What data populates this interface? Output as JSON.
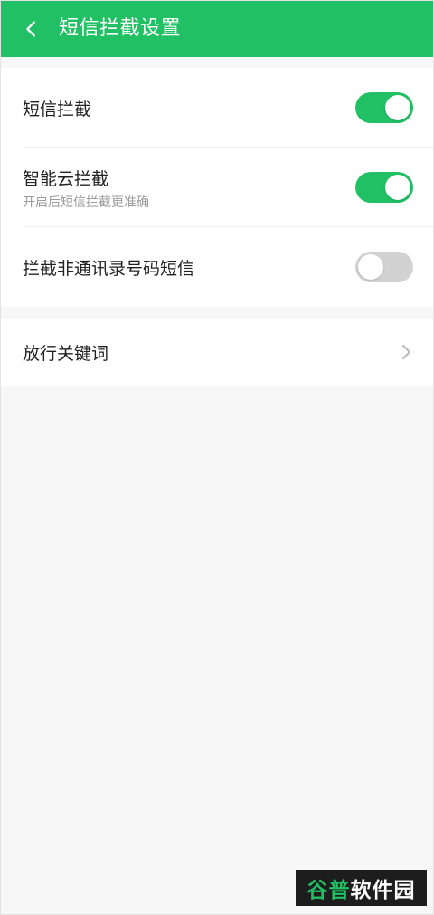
{
  "header": {
    "title": "短信拦截设置",
    "back_icon": "chevron-left-icon",
    "background_color": "#21c064"
  },
  "settings": {
    "sms_block": {
      "label": "短信拦截",
      "enabled": true
    },
    "smart_cloud_block": {
      "label": "智能云拦截",
      "subtitle": "开启后短信拦截更准确",
      "enabled": true
    },
    "block_non_contacts": {
      "label": "拦截非通讯录号码短信",
      "enabled": false
    }
  },
  "allow_keywords": {
    "label": "放行关键词",
    "icon": "chevron-right-icon"
  },
  "watermark": {
    "part_a": "谷普",
    "part_b": "软件园"
  },
  "colors": {
    "accent": "#21c064",
    "toggle_off": "#d2d2d2",
    "page_background": "#f7f7f7"
  }
}
